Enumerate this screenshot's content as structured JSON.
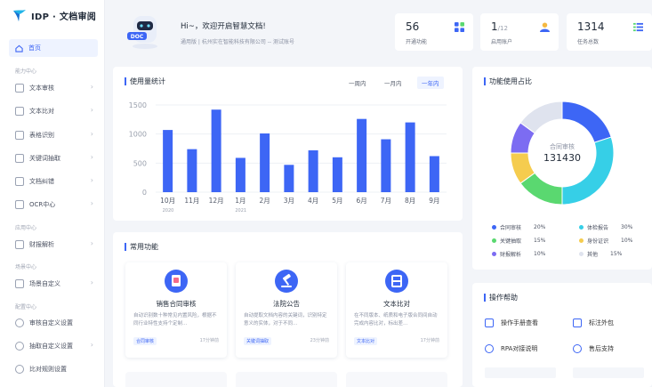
{
  "brand": {
    "name": "IDP · 文档审阅"
  },
  "sidebar": {
    "home": "首页",
    "sections": [
      {
        "title": "能力中心"
      },
      {
        "title": "应用中心"
      },
      {
        "title": "场景中心"
      },
      {
        "title": "配置中心"
      }
    ],
    "items": [
      {
        "label": "文本审核"
      },
      {
        "label": "文本比对"
      },
      {
        "label": "表格识别"
      },
      {
        "label": "关键词抽取"
      },
      {
        "label": "文档纠错"
      },
      {
        "label": "OCR中心"
      },
      {
        "label": "财报解析"
      },
      {
        "label": "场景自定义"
      },
      {
        "label": "审核自定义设置"
      },
      {
        "label": "抽取自定义设置"
      },
      {
        "label": "比对规则设置"
      }
    ]
  },
  "profile": {
    "badge": "DOC",
    "greeting": "Hi~，欢迎开启智慧文档!",
    "subtitle": "通用版 | 杭州实在智能科技有限公司 -- 测试账号"
  },
  "stats": [
    {
      "value": "56",
      "suffix": "",
      "label": "开通功能",
      "icon": "grid-icon",
      "color": "#3d66f5"
    },
    {
      "value": "1",
      "suffix": "/12",
      "label": "启用账户",
      "icon": "user-icon",
      "color": "#3d66f5"
    },
    {
      "value": "1314",
      "suffix": "",
      "label": "任务总数",
      "icon": "list-icon",
      "color": "#3d66f5"
    }
  ],
  "usage": {
    "title": "使用量统计",
    "ranges": [
      "一周内",
      "一月内",
      "一年内"
    ],
    "active_range": "一年内"
  },
  "chart_data": {
    "type": "bar",
    "categories": [
      "10月",
      "11月",
      "12月",
      "1月",
      "2月",
      "3月",
      "4月",
      "5月",
      "6月",
      "7月",
      "8月",
      "9月"
    ],
    "year_labels": [
      "2020",
      "",
      "",
      "2021",
      "",
      "",
      "",
      "",
      "",
      "",
      "",
      ""
    ],
    "values": [
      1070,
      740,
      1420,
      590,
      1010,
      470,
      720,
      600,
      1260,
      910,
      1200,
      620
    ],
    "yticks": [
      0,
      500,
      1000,
      1500
    ],
    "ylim": [
      0,
      1500
    ],
    "color": "#3d66f5",
    "grid": true
  },
  "pie": {
    "title": "功能使用占比",
    "center_label": "合同审核",
    "center_value": "131430",
    "slices": [
      {
        "name": "合同审核",
        "pct": "20%",
        "value": 20,
        "color": "#3d66f5"
      },
      {
        "name": "体检报告",
        "pct": "30%",
        "value": 30,
        "color": "#36cfe7"
      },
      {
        "name": "关键抽取",
        "pct": "15%",
        "value": 15,
        "color": "#5ad870"
      },
      {
        "name": "身份证识",
        "pct": "10%",
        "value": 10,
        "color": "#f5cc4e"
      },
      {
        "name": "财报解析",
        "pct": "10%",
        "value": 10,
        "color": "#7c6cf2"
      },
      {
        "name": "其他",
        "pct": "15%",
        "value": 15,
        "color": "#dfe3ee"
      }
    ]
  },
  "common": {
    "title": "常用功能",
    "cards": [
      {
        "title": "销售合同审核",
        "desc": "自动识别数十种常见内置风险，根据不同行业特性支持个定制…",
        "tag": "合同审核",
        "time": "17分钟前"
      },
      {
        "title": "法院公告",
        "desc": "自动提取文档内容的关键词，识别特定意义的实体，对于不同…",
        "tag": "关键词抽取",
        "time": "23分钟前"
      },
      {
        "title": "文本比对",
        "desc": "在不同版本、纸质和电子版合同间自动完成内容比对，标出差…",
        "tag": "文本比对",
        "time": "17分钟前"
      }
    ]
  },
  "help": {
    "title": "操作帮助",
    "items": [
      {
        "label": "操作手册查看",
        "icon": "book-icon"
      },
      {
        "label": "标注外包",
        "icon": "edit-icon"
      },
      {
        "label": "RPA对接说明",
        "icon": "robot-icon"
      },
      {
        "label": "售后支持",
        "icon": "support-icon"
      }
    ]
  }
}
